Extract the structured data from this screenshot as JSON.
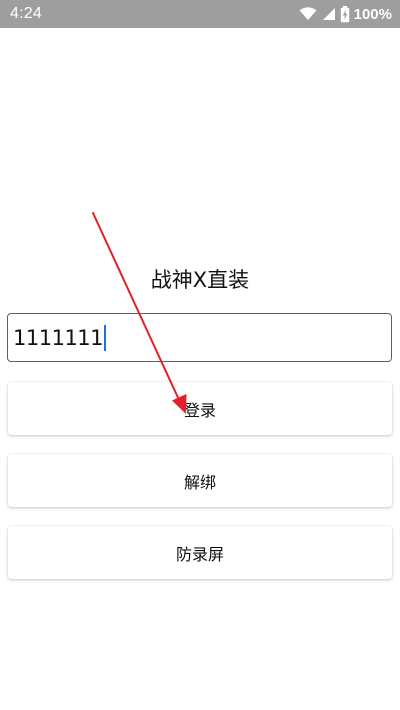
{
  "status_bar": {
    "time": "4:24",
    "battery": "100%",
    "icons": [
      "wifi-icon",
      "signal-icon",
      "battery-charging-icon"
    ]
  },
  "app": {
    "title": "战神X直装"
  },
  "input": {
    "value": "1111111"
  },
  "buttons": {
    "login": "登录",
    "unbind": "解绑",
    "anti_record": "防录屏"
  },
  "colors": {
    "status_bar_bg": "#9e9e9e",
    "caret": "#1e6fd9",
    "annotation_arrow": "#e0202a"
  }
}
